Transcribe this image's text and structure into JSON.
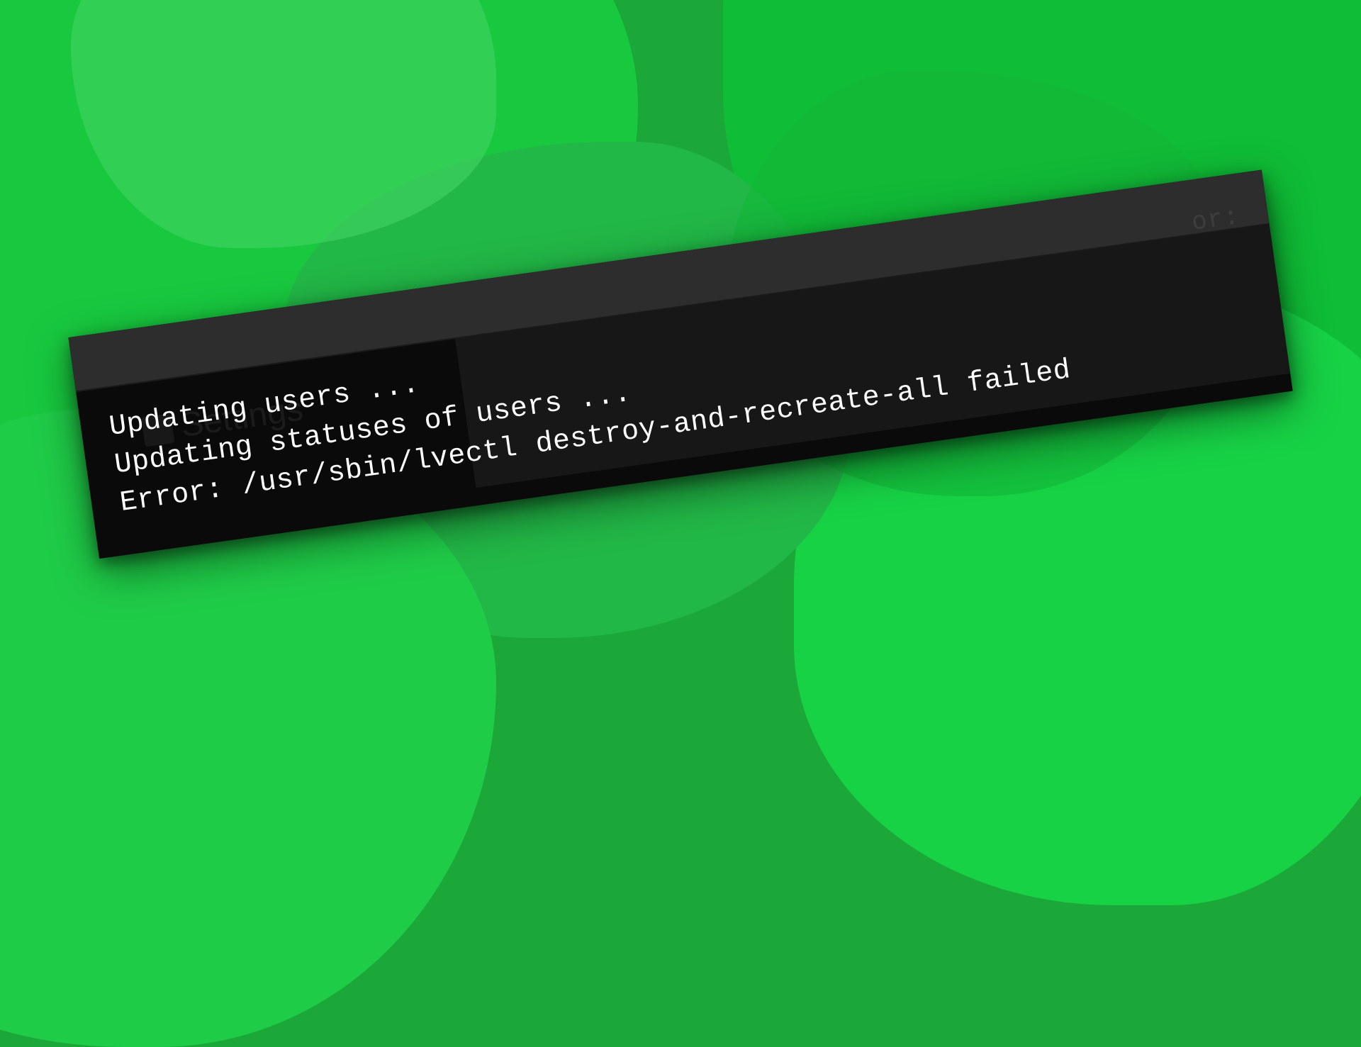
{
  "terminal": {
    "lines": [
      "Updating users ...",
      "Updating statuses of users ...",
      "Error: /usr/sbin/lvectl destroy-and-recreate-all failed"
    ],
    "faded_top": "or:",
    "faded_settings": "Settings",
    "faded_bottom": ""
  }
}
